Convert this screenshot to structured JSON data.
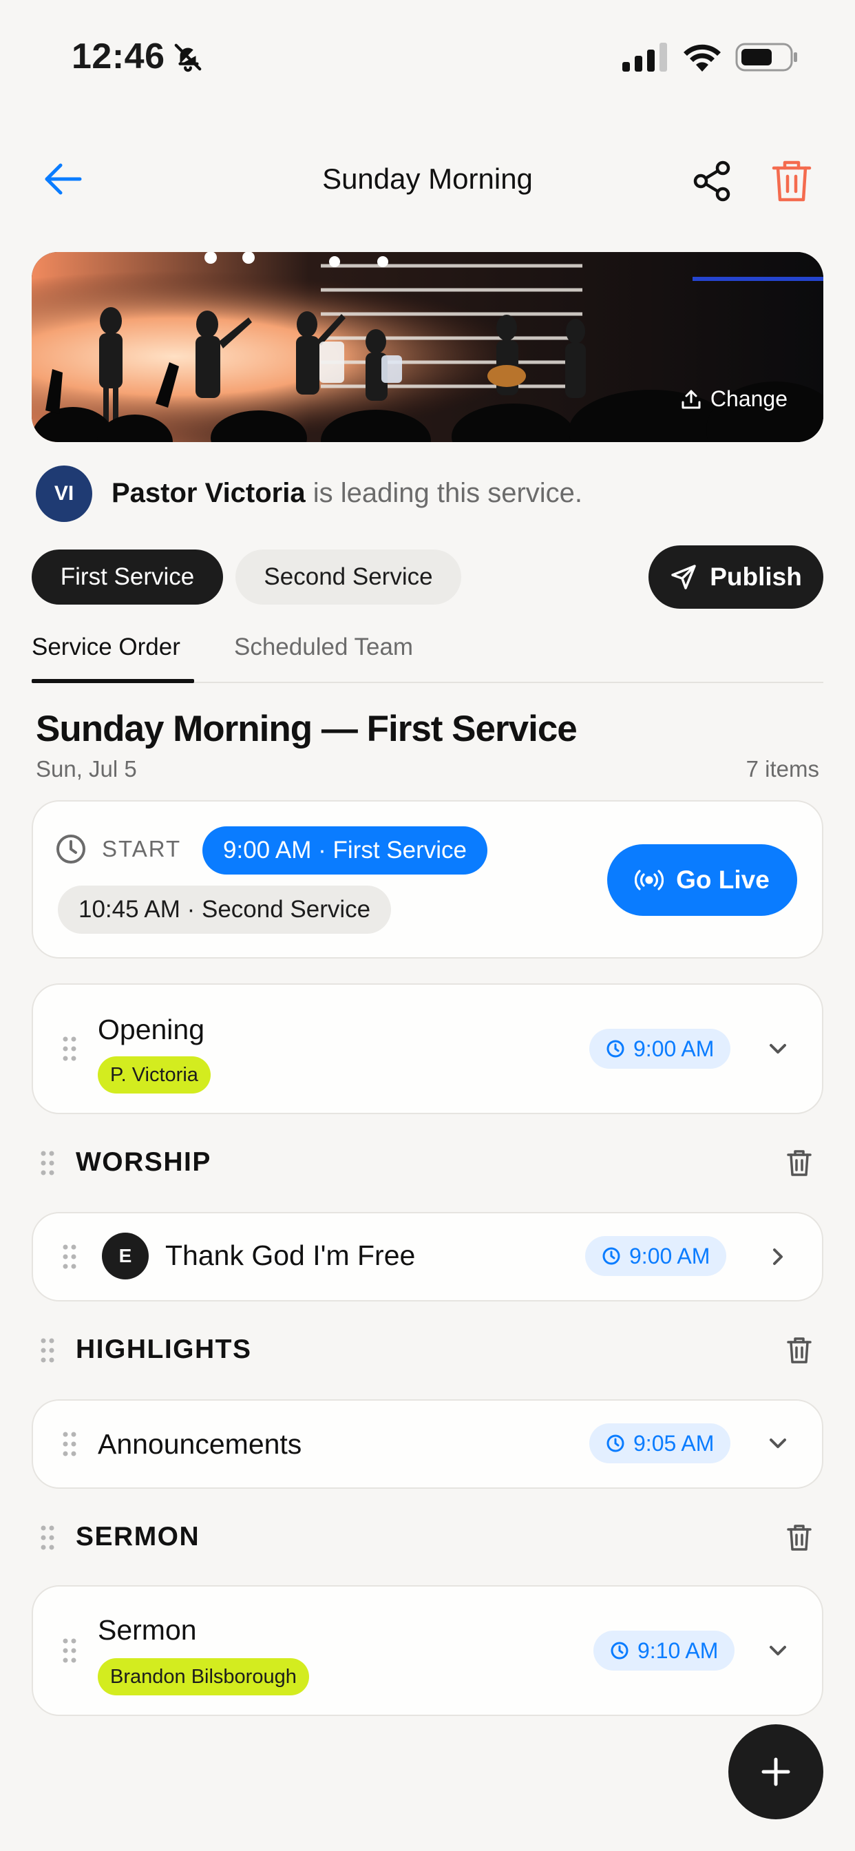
{
  "status_bar": {
    "time": "12:46"
  },
  "header": {
    "title": "Sunday Morning"
  },
  "hero": {
    "change_label": "Change"
  },
  "leader": {
    "initials": "VI",
    "name": "Pastor Victoria",
    "suffix": " is leading this service."
  },
  "services": {
    "first": "First Service",
    "second": "Second Service",
    "publish_label": "Publish"
  },
  "tabs": {
    "order": "Service Order",
    "team": "Scheduled Team"
  },
  "section": {
    "title": "Sunday Morning — First Service",
    "date": "Sun, Jul 5",
    "count": "7 items"
  },
  "start": {
    "label": "START",
    "first_time": "9:00 AM · First Service",
    "second_time": "10:45 AM · Second Service",
    "go_live_label": "Go Live"
  },
  "items": [
    {
      "title": "Opening",
      "tag": "P. Victoria",
      "time": "9:00 AM"
    },
    {
      "group": "WORSHIP"
    },
    {
      "key": "E",
      "title": "Thank God I'm Free",
      "time": "9:00 AM"
    },
    {
      "group": "HIGHLIGHTS"
    },
    {
      "title": "Announcements",
      "time": "9:05 AM"
    },
    {
      "group": "SERMON"
    },
    {
      "title": "Sermon",
      "tag": "Brandon Bilsborough",
      "time": "9:10 AM"
    }
  ],
  "colors": {
    "accent": "#0a7cff",
    "tag": "#d3ec1f",
    "danger": "#f46b4e",
    "dark": "#1c1c1c"
  }
}
